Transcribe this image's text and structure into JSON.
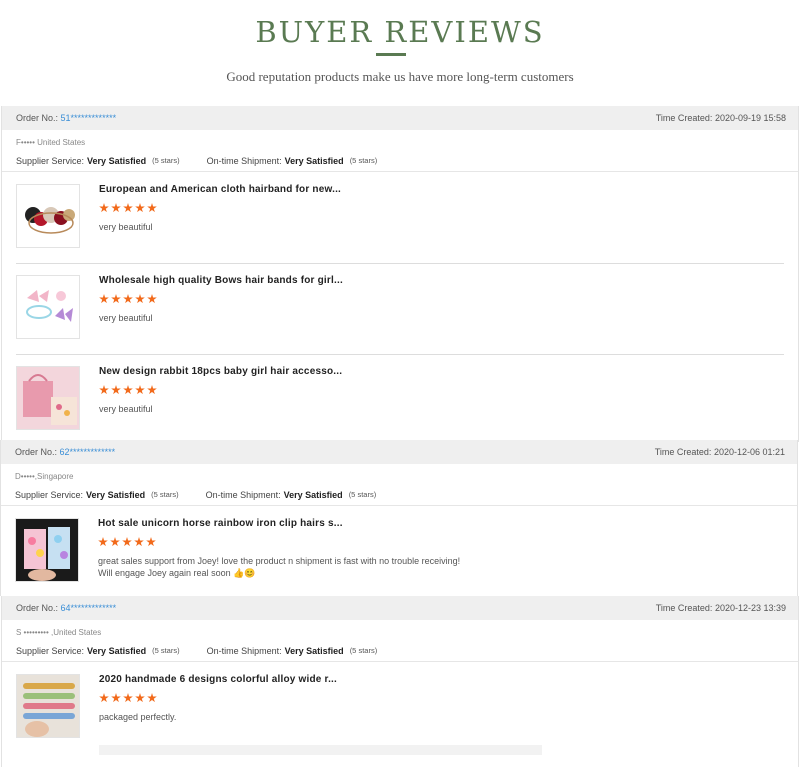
{
  "header": {
    "title": "BUYER REVIEWS",
    "subtitle": "Good reputation products make us have more long-term customers"
  },
  "labels": {
    "order_no": "Order No.:",
    "time_created": "Time Created:",
    "supplier_service": "Supplier Service:",
    "ontime_shipment": "On-time Shipment:"
  },
  "colors": {
    "accent_green": "#5a7a52",
    "star": "#f26a1b",
    "order_link": "#3a8ed6"
  },
  "orders": [
    {
      "order_no": "51*************",
      "time_created": "2020-09-19 15:58",
      "buyer": "F•••••   United States",
      "supplier_service": "Very Satisfied",
      "supplier_stars": "(5 stars)",
      "shipment": "Very Satisfied",
      "shipment_stars": "(5 stars)",
      "items": [
        {
          "name": "European and American cloth hairband for new...",
          "rating": 5,
          "comment": "very beautiful",
          "image": "hairband-image"
        },
        {
          "name": "Wholesale high quality Bows hair bands for girl...",
          "rating": 5,
          "comment": "very beautiful",
          "image": "bow-hairband-image"
        },
        {
          "name": "New design rabbit 18pcs baby girl hair accesso...",
          "rating": 5,
          "comment": "very beautiful",
          "image": "gift-box-image"
        }
      ]
    },
    {
      "order_no": "62*************",
      "time_created": "2020-12-06 01:21",
      "buyer": "D•••••,Singapore",
      "supplier_service": "Very Satisfied",
      "supplier_stars": "(5 stars)",
      "shipment": "Very Satisfied",
      "shipment_stars": "(5 stars)",
      "items": [
        {
          "name": "Hot sale unicorn horse rainbow iron clip hairs s...",
          "rating": 5,
          "comment": "great sales support from Joey! love the product n shipment is fast with no trouble receiving!",
          "comment2": "Will engage Joey again real soon 👍😊",
          "image": "hair-clips-image"
        }
      ]
    },
    {
      "order_no": "64*************",
      "time_created": "2020-12-23 13:39",
      "buyer": "S ••••••••• ,United States",
      "supplier_service": "Very Satisfied",
      "supplier_stars": "(5 stars)",
      "shipment": "Very Satisfied",
      "shipment_stars": "(5 stars)",
      "items": [
        {
          "name": "2020 handmade 6 designs colorful alloy wide r...",
          "rating": 5,
          "comment": "packaged perfectly.",
          "image": "alloy-hairpins-image"
        }
      ]
    }
  ]
}
